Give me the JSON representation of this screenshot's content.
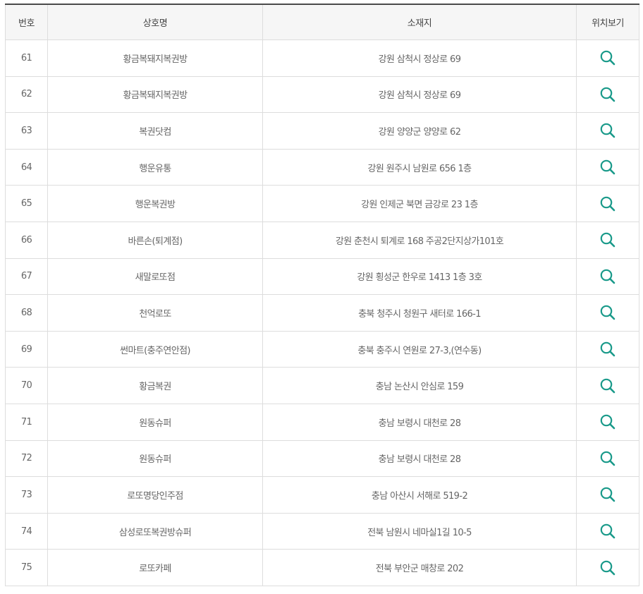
{
  "table": {
    "headers": {
      "number": "번호",
      "name": "상호명",
      "address": "소재지",
      "location": "위치보기"
    },
    "icon": "magnifier-search-icon",
    "icon_color": "#1a9a8a",
    "rows": [
      {
        "number": "61",
        "name": "황금복돼지복권방",
        "address": "강원 삼척시 정상로 69"
      },
      {
        "number": "62",
        "name": "황금복돼지복권방",
        "address": "강원 삼척시 정상로 69"
      },
      {
        "number": "63",
        "name": "복권닷컴",
        "address": "강원 양양군 양양로 62"
      },
      {
        "number": "64",
        "name": "행운유통",
        "address": "강원 원주시 남원로 656 1층"
      },
      {
        "number": "65",
        "name": "행운복권방",
        "address": "강원 인제군 북면 금강로 23 1층"
      },
      {
        "number": "66",
        "name": "바른손(퇴계점)",
        "address": "강원 춘천시 퇴계로 168 주공2단지상가101호"
      },
      {
        "number": "67",
        "name": "새말로또점",
        "address": "강원 횡성군 한우로 1413 1층 3호"
      },
      {
        "number": "68",
        "name": "천억로또",
        "address": "충북 청주시 청원구 새터로 166-1"
      },
      {
        "number": "69",
        "name": "썬마트(충주연안점)",
        "address": "충북 충주시 연원로 27-3,(연수동)"
      },
      {
        "number": "70",
        "name": "황금복권",
        "address": "충남 논산시 안심로 159"
      },
      {
        "number": "71",
        "name": "원동슈퍼",
        "address": "충남 보령시 대천로 28"
      },
      {
        "number": "72",
        "name": "원동슈퍼",
        "address": "충남 보령시 대천로 28"
      },
      {
        "number": "73",
        "name": "로또명당인주점",
        "address": "충남 아산시 서해로 519-2"
      },
      {
        "number": "74",
        "name": "삼성로또복권방슈퍼",
        "address": "전북 남원시 네마실1길 10-5"
      },
      {
        "number": "75",
        "name": "로또카페",
        "address": "전북 부안군 매창로 202"
      }
    ]
  }
}
